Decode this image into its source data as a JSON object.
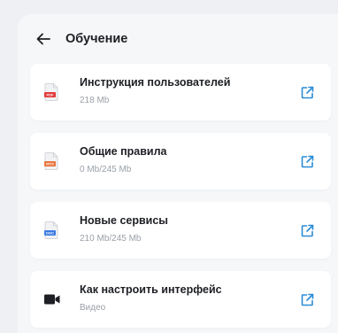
{
  "header": {
    "title": "Обучение",
    "back_icon": "arrow-left-icon"
  },
  "items": [
    {
      "title": "Инструкция пользователей",
      "subtitle": "218 Mb",
      "icon": "pdf-file-icon",
      "icon_label": "PDF",
      "icon_color": "#e23b3b"
    },
    {
      "title": "Общие правила",
      "subtitle": "0 Mb/245 Mb",
      "icon": "pptx-file-icon",
      "icon_label": "PPTX",
      "icon_color": "#e8743b"
    },
    {
      "title": "Новые сервисы",
      "subtitle": "210 Mb/245 Mb",
      "icon": "doc-file-icon",
      "icon_label": "DOC",
      "icon_color": "#3b7be2"
    },
    {
      "title": "Как настроить интерфейс",
      "subtitle": "Видео",
      "icon": "video-icon",
      "icon_color": "#1d1f24"
    }
  ],
  "colors": {
    "accent": "#2a8cd6",
    "text": "#1d1f24",
    "muted": "#9aa0a8",
    "background": "#eef0f3",
    "card": "#ffffff"
  }
}
